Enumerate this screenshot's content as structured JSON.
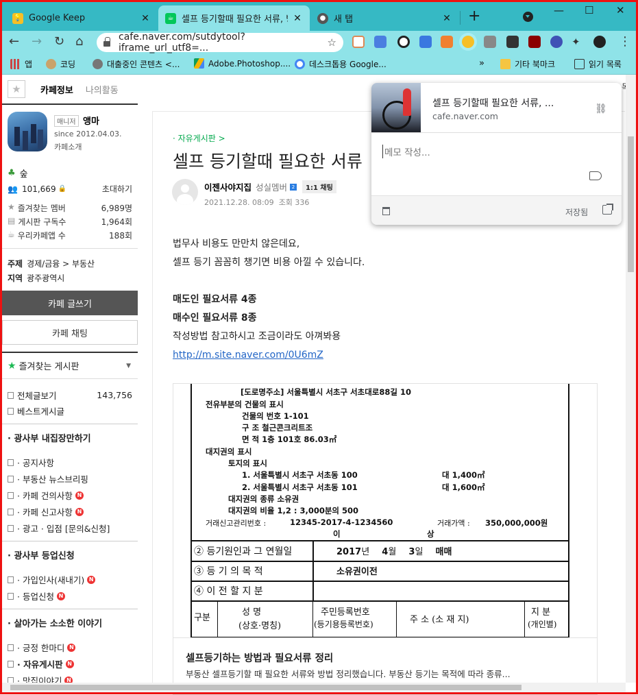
{
  "tabs": [
    {
      "title": "Google Keep",
      "icon": "google-keep-icon",
      "color": "#f6bf26"
    },
    {
      "title": "셀프 등기할때 필요한 서류, 방",
      "icon": "naver-cafe-icon",
      "color": "#03c75a"
    },
    {
      "title": "새 탭",
      "icon": "chrome-icon",
      "color": "#555555"
    }
  ],
  "toolbar": {
    "url": "cafe.naver.com/sutdytool?iframe_url_utf8=..."
  },
  "bookmarks": [
    {
      "label": "앱",
      "icon": "apps-grid-icon"
    },
    {
      "label": "코딩",
      "icon": "dog-icon"
    },
    {
      "label": "대출중인 콘텐츠 <...",
      "icon": "globe-icon"
    },
    {
      "label": "Adobe.Photoshop....",
      "icon": "google-drive-icon"
    },
    {
      "label": "데스크톱용 Google...",
      "icon": "google-icon"
    },
    {
      "label": "기타 북마크",
      "icon": "folder-icon"
    },
    {
      "label": "읽기 목록",
      "icon": "reading-list-icon"
    }
  ],
  "sidebar": {
    "tab_info": "카페정보",
    "tab_activity": "나의활동",
    "manager_tag": "매니저",
    "manager_name": "앵마",
    "since": "since 2012.04.03.",
    "intro": "카페소개",
    "level": "숲",
    "members": "101,669",
    "invite": "초대하기",
    "stats": [
      {
        "label": "즐겨찾는 멤버",
        "value": "6,989명"
      },
      {
        "label": "게시판 구독수",
        "value": "1,964회"
      },
      {
        "label": "우리카페앱 수",
        "value": "188회"
      }
    ],
    "topic_label": "주제",
    "topic_value": "경제/금융 > 부동산",
    "region_label": "지역",
    "region_value": "광주광역시",
    "write_button": "카페 글쓰기",
    "chat_button": "카페 채팅",
    "fav_boards": "즐겨찾는 게시판",
    "boards_top": [
      {
        "label": "전체글보기",
        "count": "143,756"
      },
      {
        "label": "베스트게시글",
        "count": ""
      }
    ],
    "group1": "· 광사부 내집장만하기",
    "boards_g1": [
      {
        "label": "· 공지사항",
        "new": false
      },
      {
        "label": "· 부동산 뉴스브리핑",
        "new": false
      },
      {
        "label": "· 카페 건의사항",
        "new": true
      },
      {
        "label": "· 카페 신고사항",
        "new": true
      },
      {
        "label": "· 광고 · 입점 [문의&신청]",
        "new": false
      }
    ],
    "group2": "· 광사부 등업신청",
    "boards_g2": [
      {
        "label": "· 가입인사(새내기)",
        "new": true
      },
      {
        "label": "· 등업신청",
        "new": true
      }
    ],
    "group3": "· 살아가는 소소한 이야기",
    "boards_g3": [
      {
        "label": "· 긍정 한마디",
        "new": true
      },
      {
        "label": "· 자유게시판",
        "new": true
      },
      {
        "label": "· 맛집이야기",
        "new": true
      }
    ],
    "new_badge": "N"
  },
  "article": {
    "breadcrumb": "자유게시판 >",
    "title": "셀프 등기할때 필요한 서류",
    "author": "이젠사야지집",
    "rank": "성실멤버",
    "level_badge": "2",
    "chat": "1:1 채팅",
    "date": "2021.12.28. 08:09",
    "views": "조회 336",
    "lines": [
      "법무사 비용도 만만치 않은데요,",
      "셀프 등기 꼼꼼히 챙기면 비용 아낄 수 있습니다.",
      "",
      "매도인 필요서류 4종",
      "매수인 필요서류 8종",
      "작성방법 참고하시고 조금이라도 아껴봐용"
    ],
    "link": "http://m.site.naver.com/0U6mZ"
  },
  "document": {
    "road_addr": "[도로명주소] 서울특별시 서초구 서초대로88길 10",
    "building": "전유부분의 건물의 표시",
    "bldg_no": "건물의 번호   1-101",
    "structure": "구          조   철근콘크리트조",
    "area": "면          적   1층 101호 86.03㎡",
    "land_rights": "대지권의 표시",
    "land": "토지의 표시",
    "land1": "1. 서울특별시 서초구 서초동 100",
    "land1_v": "대  1,400㎡",
    "land2": "2. 서울특별시 서초구 서초동 101",
    "land2_v": "대  1,600㎡",
    "kind": "대지권의 종류   소유권",
    "ratio": "대지권의 비율 1,2 :   3,000분의 500",
    "report_label": "거래신고관리번호 :",
    "report_no": "12345-2017-4-1234560",
    "price_label": "거래가액 :",
    "price": "350,000,000원",
    "isang1": "이",
    "isang2": "상",
    "row2_label": "② 등기원인과 그 연월일",
    "row2_year": "2017",
    "row2_year_unit": "년",
    "row2_month": "4",
    "row2_month_unit": "월",
    "row2_day": "3",
    "row2_day_unit": "일",
    "row2_cause": "매매",
    "row3_label": "③ 등 기 의 목 적",
    "row3_value": "소유권이전",
    "row4_label": "④ 이 전 할 지 분",
    "col_gubun": "구분",
    "col_name1": "성       명",
    "col_name2": "(상호·명칭)",
    "col_id1": "주민등록번호",
    "col_id2": "(등기용등록번호)",
    "col_addr": "주      소 (소 재 지)",
    "col_share1": "지  분",
    "col_share2": "(개인별)"
  },
  "card": {
    "title": "셀프등기하는 방법과 필요서류 정리",
    "desc": "부동산 셀프등기할 때 필요한 서류와 방법 정리했습니다. 부동산 등기는 목적에 따라 종류..."
  },
  "keep": {
    "title": "셀프 등기할때 필요한 서류, ...",
    "url": "cafe.naver.com",
    "memo_placeholder": "메모 작성...",
    "saved": "저장됨"
  },
  "peek_text": "목록"
}
